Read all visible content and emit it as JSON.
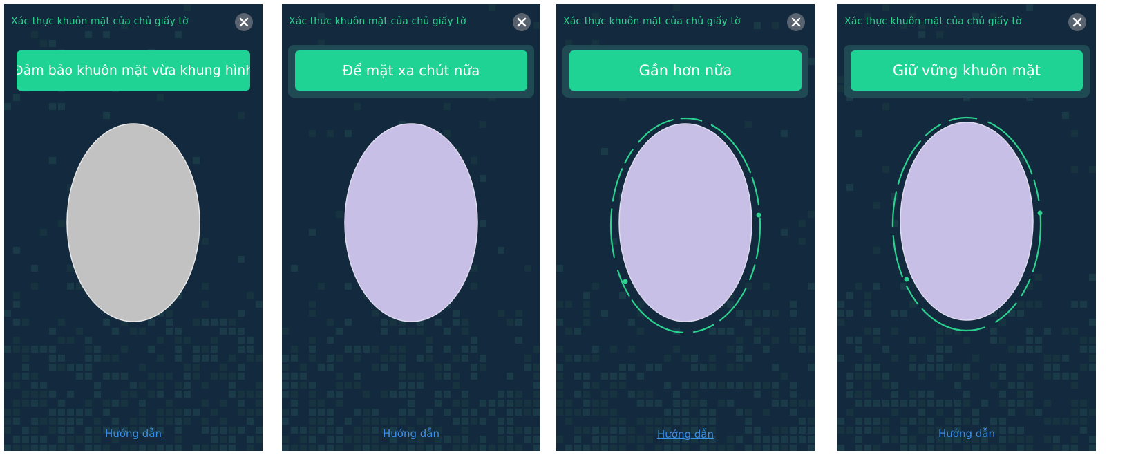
{
  "colors": {
    "panel_bg": "#13293d",
    "title_green": "#2bd28f",
    "message_green": "#1fd394",
    "message_frame": "#1f4a53",
    "oval_initial": "#c2c2c2",
    "oval_active": "#c8bfe6",
    "progress_arc": "#2bd28f",
    "link_blue": "#3a8fe8"
  },
  "screens": [
    {
      "title": "Xác thực khuôn mặt của chủ giấy tờ",
      "message": "Đảm bảo khuôn mặt vừa khung hình",
      "guide_link": "Hướng dẫn",
      "close_icon": "close-icon",
      "oval_state": "initial",
      "progress_arcs": false
    },
    {
      "title": "Xác thực khuôn mặt của chủ giấy tờ",
      "message": "Để mặt xa chút nữa",
      "guide_link": "Hướng dẫn",
      "close_icon": "close-icon",
      "oval_state": "active",
      "progress_arcs": false
    },
    {
      "title": "Xác thực khuôn mặt của chủ giấy tờ",
      "message": "Gần hơn nữa",
      "guide_link": "Hướng dẫn",
      "close_icon": "close-icon",
      "oval_state": "active",
      "progress_arcs": true
    },
    {
      "title": "Xác thực khuôn mặt của chủ giấy tờ",
      "message": "Giữ vững khuôn mặt",
      "guide_link": "Hướng dẫn",
      "close_icon": "close-icon",
      "oval_state": "active",
      "progress_arcs": true
    }
  ]
}
